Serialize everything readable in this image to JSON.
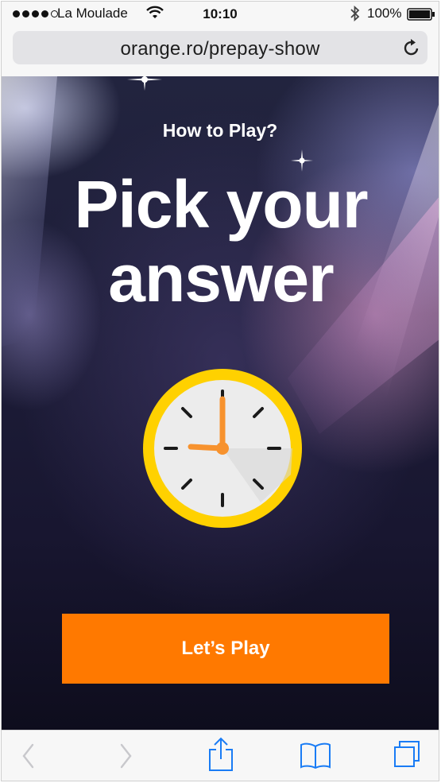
{
  "status_bar": {
    "carrier": "La Moulade",
    "time": "10:10",
    "battery_percent": "100%",
    "signal_dots_filled": 4,
    "signal_dots_total": 5
  },
  "browser": {
    "url": "orange.ro/prepay-show",
    "icons": {
      "reload": "reload-icon",
      "back": "back-icon",
      "forward": "forward-icon",
      "share": "share-icon",
      "bookmarks": "bookmarks-icon",
      "tabs": "tabs-icon"
    }
  },
  "page": {
    "subtitle": "How to Play?",
    "headline": "Pick your answer",
    "cta_label": "Let’s Play"
  },
  "colors": {
    "brand_orange": "#ff7900",
    "ios_blue": "#1a7cf5",
    "clock_ring": "#ffd100",
    "clock_hands": "#f7922e"
  }
}
